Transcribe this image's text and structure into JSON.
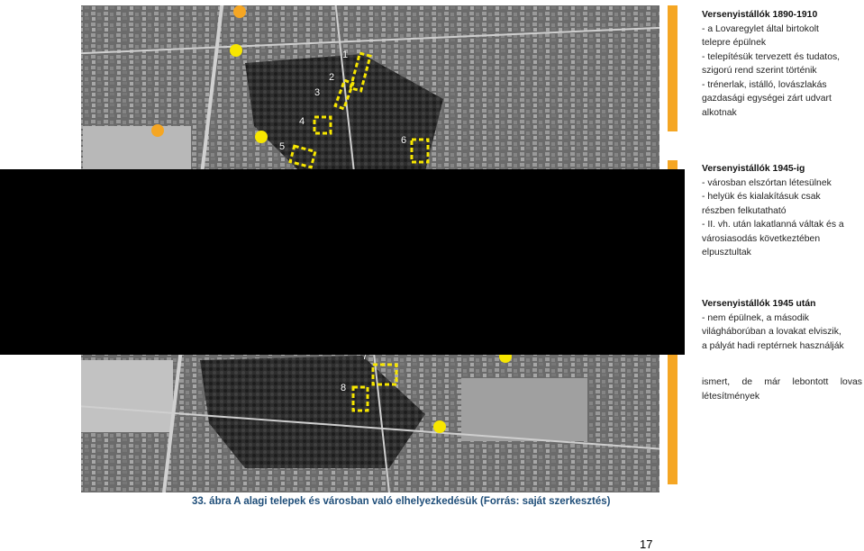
{
  "map": {
    "labels": [
      "1",
      "2",
      "3",
      "4",
      "5",
      "6",
      "7",
      "8"
    ]
  },
  "sidebar": {
    "section1": {
      "title": "Versenyistállók 1890-1910",
      "lines": [
        "- a Lovaregylet által birtokolt",
        "telepre épülnek",
        "- telepítésük tervezett és tudatos,",
        "szigorú rend szerint történik",
        "- trénerlak, istálló, lovászlakás",
        "gazdasági egységei zárt udvart",
        "alkotnak"
      ]
    },
    "section2": {
      "title": "Versenyistállók 1945-ig",
      "lines": [
        "- városban elszórtan létesülnek",
        "- helyük és kialakításuk csak",
        "részben felkutatható",
        "- II. vh. után lakatlanná váltak és a",
        "városiasodás következtében",
        "elpusztultak"
      ]
    },
    "section3": {
      "title": "Versenyistállók 1945 után",
      "lines": [
        "- nem épülnek, a második",
        "világháborúban a lovakat elviszik,",
        "a pályát hadi reptérnek használják"
      ]
    },
    "section4": {
      "lines": [
        "ismert, de már lebontott lovas",
        "létesítmények"
      ]
    }
  },
  "caption": "33. ábra A alagi telepek és városban való elhelyezkedésük (Forrás: saját szerkesztés)",
  "page_number": "17",
  "colors": {
    "marker_yellow": "#f7e600",
    "marker_orange": "#f5a623",
    "caption_blue": "#1f4e79"
  }
}
